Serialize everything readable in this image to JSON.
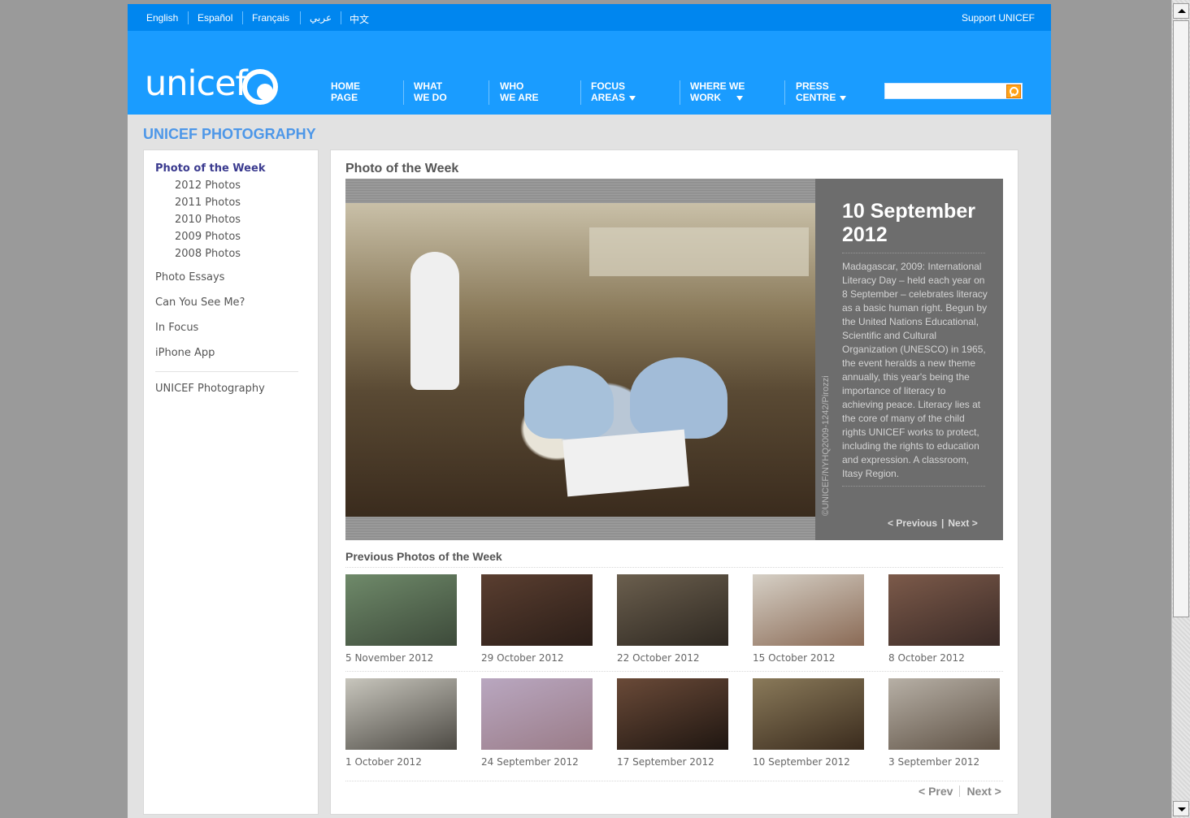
{
  "languages": [
    "English",
    "Español",
    "Français",
    "عربي",
    "中文"
  ],
  "support_link": "Support UNICEF",
  "logo_text": "unicef",
  "nav": {
    "home": [
      "HOME",
      "PAGE"
    ],
    "what": [
      "WHAT",
      "WE DO"
    ],
    "who": [
      "WHO",
      "WE ARE"
    ],
    "focus": [
      "FOCUS",
      "AREAS"
    ],
    "where": [
      "WHERE WE",
      "WORK"
    ],
    "press": [
      "PRESS",
      "CENTRE"
    ]
  },
  "search": {
    "placeholder": ""
  },
  "section_title": "UNICEF PHOTOGRAPHY",
  "sidebar": {
    "active": "Photo of the Week",
    "years": [
      "2012 Photos",
      "2011 Photos",
      "2010 Photos",
      "2009 Photos",
      "2008 Photos"
    ],
    "links": [
      "Photo Essays",
      "Can You See Me?",
      "In Focus",
      "iPhone App"
    ],
    "footer": "UNICEF Photography"
  },
  "main": {
    "title": "Photo of the Week",
    "feature": {
      "date_line1": "10 September",
      "date_line2": "2012",
      "credit": "©UNICEF/NYHQ2009-1242/Pirozzi",
      "caption": "Madagascar, 2009: International Literacy Day – held each year on 8 September – celebrates literacy as a basic human right. Begun by the United Nations Educational, Scientific and Cultural Organization (UNESCO) in 1965, the event heralds a new theme annually, this year's being the importance of literacy to achieving peace. Literacy lies at the core of many of the child rights UNICEF works to protect, including the rights to education and expression. A classroom, Itasy Region.",
      "prev": "< Previous",
      "next": "Next >"
    },
    "previous_title": "Previous Photos of the Week",
    "thumbs": [
      {
        "caption": "5 November 2012",
        "colors": [
          "#6f8a6a",
          "#3d4a3a"
        ]
      },
      {
        "caption": "29 October 2012",
        "colors": [
          "#5a3e30",
          "#2b1e18"
        ]
      },
      {
        "caption": "22 October 2012",
        "colors": [
          "#6b5f4e",
          "#2e2821"
        ]
      },
      {
        "caption": "15 October 2012",
        "colors": [
          "#d6d0c6",
          "#8a6a55"
        ]
      },
      {
        "caption": "8 October 2012",
        "colors": [
          "#7c5a4a",
          "#3a2a26"
        ]
      },
      {
        "caption": "1 October 2012",
        "colors": [
          "#c8c6bd",
          "#4d4a44"
        ]
      },
      {
        "caption": "24 September 2012",
        "colors": [
          "#b9a7c0",
          "#9a7c88"
        ]
      },
      {
        "caption": "17 September 2012",
        "colors": [
          "#6a4a38",
          "#1f1611"
        ]
      },
      {
        "caption": "10 September 2012",
        "colors": [
          "#8a7a5a",
          "#3a2b1d"
        ]
      },
      {
        "caption": "3 September 2012",
        "colors": [
          "#b7b0a6",
          "#5f5245"
        ]
      }
    ],
    "pager": {
      "prev": "< Prev",
      "next": "Next >"
    }
  }
}
